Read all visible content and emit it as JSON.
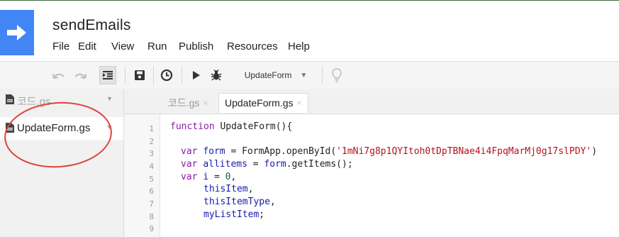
{
  "app": {
    "title": "sendEmails"
  },
  "menu": [
    "File",
    "Edit",
    "View",
    "Run",
    "Publish",
    "Resources",
    "Help"
  ],
  "toolbar": {
    "function_select": "UpdateForm"
  },
  "files": [
    {
      "name": "코드.gs"
    },
    {
      "name": "UpdateForm.gs"
    }
  ],
  "tabs": [
    {
      "label": "코드.gs",
      "close": "×"
    },
    {
      "label": "UpdateForm.gs",
      "close": "×"
    }
  ],
  "editor": {
    "line_numbers": [
      "1",
      "2",
      "3",
      "4",
      "5",
      "6",
      "7",
      "8",
      "9"
    ],
    "lines": [
      {
        "n": 1,
        "tokens": [
          {
            "t": "kw",
            "s": "function "
          },
          {
            "t": "pl",
            "s": "UpdateForm(){"
          }
        ]
      },
      {
        "n": 2,
        "tokens": []
      },
      {
        "n": 3,
        "tokens": [
          {
            "t": "kw",
            "s": "var "
          },
          {
            "t": "vr",
            "s": "form"
          },
          {
            "t": "pl",
            "s": " = FormApp.openById("
          },
          {
            "t": "str",
            "s": "'1mNi7g8p1QYItoh0tDpTBNae4i4FpqMarMj0g17slPDY'"
          },
          {
            "t": "pl",
            "s": ")"
          }
        ]
      },
      {
        "n": 4,
        "tokens": [
          {
            "t": "kw",
            "s": "var "
          },
          {
            "t": "vr",
            "s": "allitems"
          },
          {
            "t": "pl",
            "s": " = "
          },
          {
            "t": "vr",
            "s": "form"
          },
          {
            "t": "pl",
            "s": ".getItems();"
          }
        ]
      },
      {
        "n": 5,
        "tokens": [
          {
            "t": "kw",
            "s": "var "
          },
          {
            "t": "vr",
            "s": "i"
          },
          {
            "t": "pl",
            "s": " = "
          },
          {
            "t": "num",
            "s": "0"
          },
          {
            "t": "pl",
            "s": ","
          }
        ]
      },
      {
        "n": 6,
        "tokens": [
          {
            "t": "vr",
            "s": "thisItem"
          },
          {
            "t": "pl",
            "s": ","
          }
        ]
      },
      {
        "n": 7,
        "tokens": [
          {
            "t": "vr",
            "s": "thisItemType"
          },
          {
            "t": "pl",
            "s": ","
          }
        ]
      },
      {
        "n": 8,
        "tokens": [
          {
            "t": "vr",
            "s": "myListItem"
          },
          {
            "t": "pl",
            "s": ";"
          }
        ]
      },
      {
        "n": 9,
        "tokens": []
      }
    ]
  },
  "colors": {
    "brand": "#4285f4",
    "annotation": "#e0413c"
  }
}
